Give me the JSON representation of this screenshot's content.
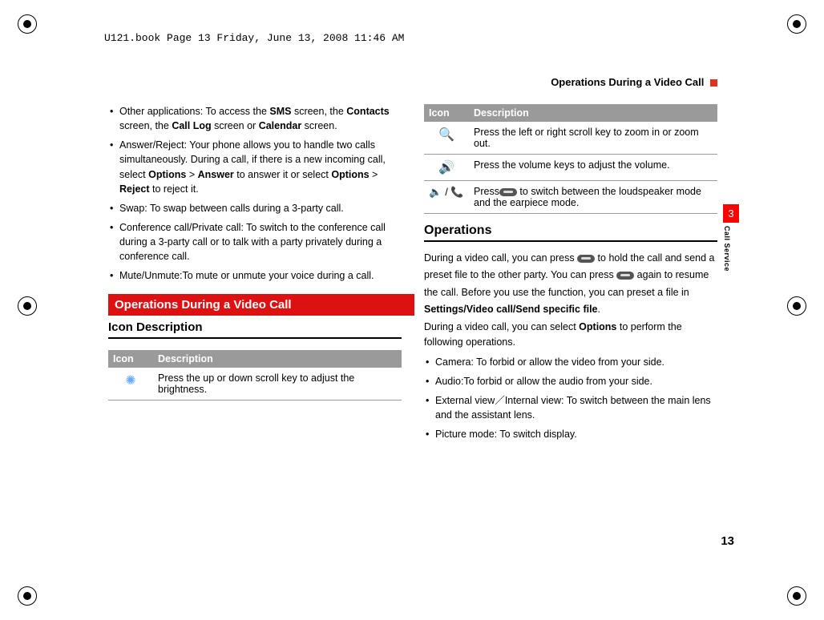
{
  "header": "U121.book  Page 13  Friday, June 13, 2008  11:46 AM",
  "running_head": "Operations During a Video Call",
  "side_tab": {
    "num": "3",
    "label": "Call Service"
  },
  "page_number": "13",
  "left": {
    "bullets": [
      {
        "prefix": "Other applications: To access the ",
        "b1": "SMS",
        "mid1": " screen, the ",
        "b2": "Contacts",
        "mid2": " screen, the ",
        "b3": "Call Log",
        "mid3": " screen or ",
        "b4": "Calendar",
        "suffix": " screen."
      },
      {
        "prefix": "Answer/Reject: Your phone allows you to handle two calls simultaneously. During a call, if there is a new incoming call, select ",
        "b1": "Options",
        "mid1": " > ",
        "b2": "Answer",
        "mid2": " to answer it or select ",
        "b3": "Options",
        "mid3": " > ",
        "b4": "Reject",
        "suffix": " to reject it."
      },
      {
        "plain": "Swap: To swap between calls during a 3-party call."
      },
      {
        "plain": "Conference call/Private call: To switch to the conference call during a 3-party call or to talk with a party privately during a conference call."
      },
      {
        "plain": "Mute/Unmute:To mute or unmute your voice during a call."
      }
    ],
    "section_bar": "Operations During a Video  Call",
    "subhead": "Icon Description",
    "table": {
      "head_icon": "Icon",
      "head_desc": "Description",
      "rows": [
        {
          "icon": "✺",
          "desc": "Press the up or down scroll key to adjust the brightness."
        }
      ]
    }
  },
  "right": {
    "table": {
      "head_icon": "Icon",
      "head_desc": "Description",
      "rows": [
        {
          "icon": "🔍",
          "desc": "Press the left or right scroll key to zoom in or zoom out."
        },
        {
          "icon": "🔊",
          "desc": "Press the volume keys to adjust the volume."
        },
        {
          "icon": "🔈 / 📞",
          "desc_pre": "Press",
          "desc_post": " to switch between the loudspeaker mode and the earpiece mode."
        }
      ]
    },
    "ops_head": "Operations",
    "para1_a": "During a video call, you can press ",
    "para1_b": " to hold the call and send a preset file to the other party. You can press ",
    "para1_c": " again to resume the call. Before you use the function, you can preset a file in ",
    "para1_bold": "Settings/Video call/Send specific file",
    "para1_d": ".",
    "para2_a": "During a video call, you can select ",
    "para2_bold": "Options",
    "para2_b": " to perform the following operations.",
    "bullets": [
      "Camera: To forbid or allow the video from your side.",
      "Audio:To forbid or allow the audio from your side.",
      "External view／Internal view: To switch between the main lens and the assistant lens.",
      "Picture mode: To switch display."
    ]
  }
}
